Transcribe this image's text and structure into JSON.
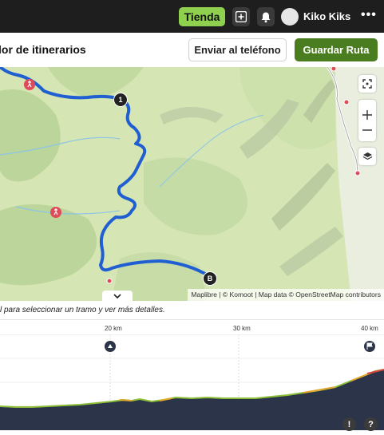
{
  "topbar": {
    "store_label": "Tienda",
    "username": "Kiko Kiks",
    "more_label": "•••",
    "icons": [
      "add-icon",
      "bell-icon",
      "avatar",
      "more-icon"
    ]
  },
  "header": {
    "title": "lor de itinerarios",
    "send_label": "Enviar al teléfono",
    "save_label": "Guardar Ruta",
    "colors": {
      "save": "#4a7d1f",
      "store": "#8fd14f",
      "route": "#1f5fd1"
    }
  },
  "map": {
    "waypoints": [
      {
        "label": "1"
      },
      {
        "label": "B"
      }
    ],
    "attribution": "Maplibre | © Komoot | Map data © OpenStreetMap contributors",
    "controls": [
      "fullscreen-icon",
      "zoom-in-icon",
      "zoom-out-icon",
      "layers-icon"
    ]
  },
  "hint": "l para seleccionar un tramo y ver más detalles.",
  "profile": {
    "km_labels": [
      "20 km",
      "30 km",
      "40 km"
    ],
    "buttons": [
      "alert-icon",
      "help-icon"
    ]
  }
}
